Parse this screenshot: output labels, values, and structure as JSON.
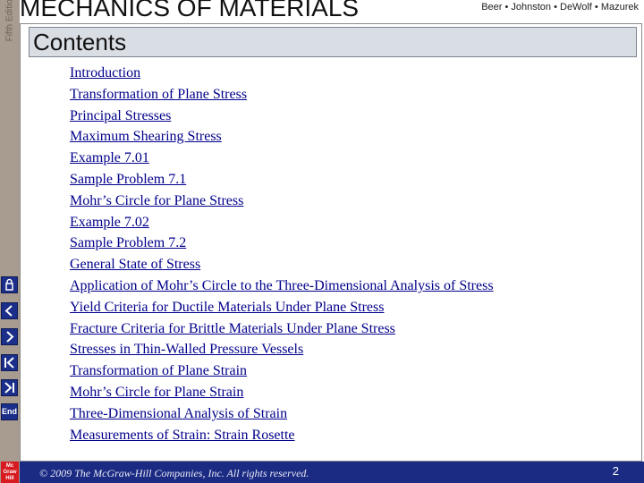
{
  "header": {
    "title": "MECHANICS OF MATERIALS",
    "edition": "Fifth Edition",
    "authors": "Beer • Johnston • DeWolf • Mazurek"
  },
  "slide": {
    "heading": "Contents",
    "items": [
      "Introduction",
      "Transformation of Plane Stress",
      "Principal Stresses",
      "Maximum Shearing Stress",
      "Example 7.01",
      "Sample Problem 7.1",
      "Mohr’s Circle for Plane Stress",
      "Example 7.02",
      "Sample Problem 7.2",
      "General State of Stress",
      "Application of Mohr’s Circle to the Three-Dimensional Analysis of Stress",
      "Yield Criteria for Ductile Materials Under Plane Stress",
      "Fracture Criteria for Brittle Materials Under Plane Stress",
      "Stresses in Thin-Walled Pressure Vessels",
      "Transformation of Plane Strain",
      "Mohr’s Circle for Plane Strain",
      "Three-Dimensional Analysis of Strain",
      "Measurements of Strain: Strain Rosette"
    ]
  },
  "nav": {
    "end_label": "End",
    "icons": [
      "home-icon",
      "previous-icon",
      "next-icon",
      "first-icon",
      "last-icon",
      "end-icon"
    ]
  },
  "logo": {
    "text": "Mc Graw Hill"
  },
  "footer": {
    "copyright": "© 2009 The McGraw-Hill Companies, Inc. All rights reserved.",
    "page": "2"
  },
  "colors": {
    "link": "#00008b",
    "footer_bg": "#1b2b84",
    "sidebar_bg": "#a89b8f",
    "heading_bg": "#d9dde4",
    "nav_button": "#1b2f8a"
  }
}
